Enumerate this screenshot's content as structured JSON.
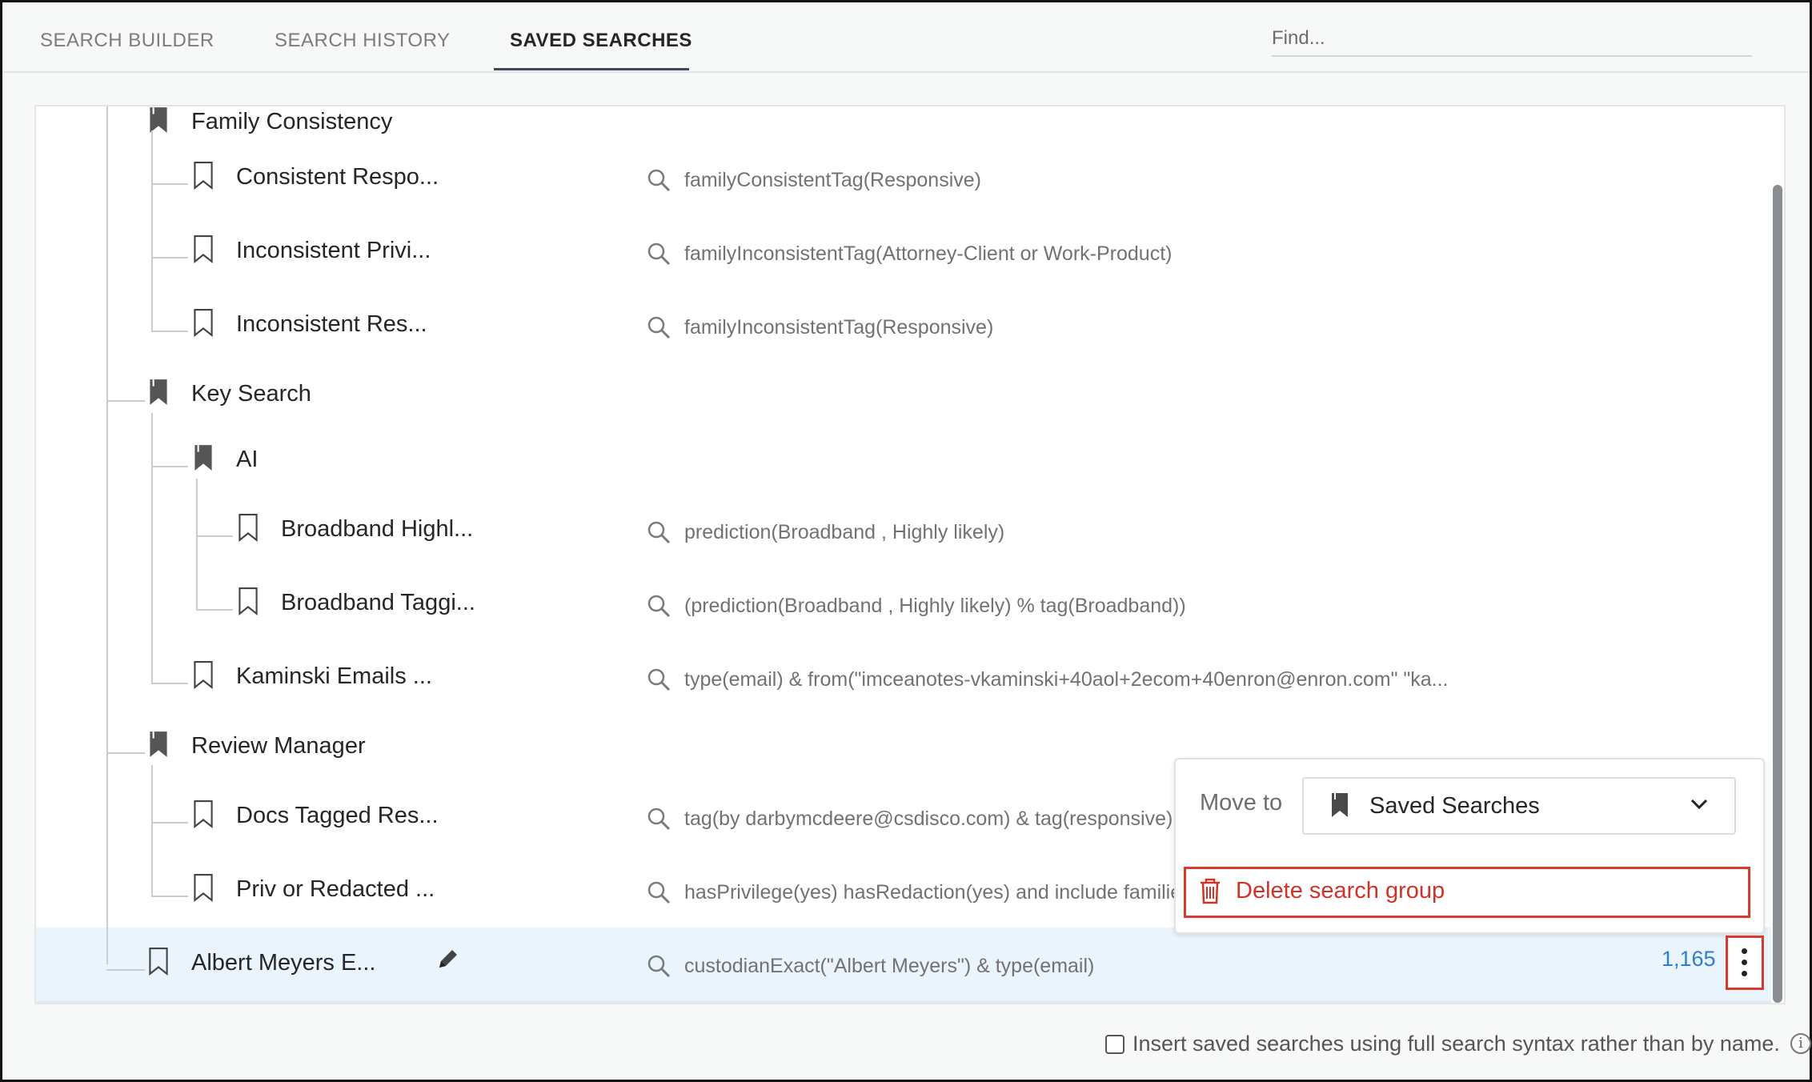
{
  "tabs": [
    {
      "label": "SEARCH BUILDER",
      "active": false
    },
    {
      "label": "SEARCH HISTORY",
      "active": false
    },
    {
      "label": "SAVED SEARCHES",
      "active": true
    }
  ],
  "find": {
    "placeholder": "Find..."
  },
  "rows": [
    {
      "type": "group",
      "name": "Family Consistency",
      "query": ""
    },
    {
      "type": "search",
      "name": "Consistent Respo...",
      "query": "familyConsistentTag(Responsive)"
    },
    {
      "type": "search",
      "name": "Inconsistent Privi...",
      "query": "familyInconsistentTag(Attorney-Client or Work-Product)"
    },
    {
      "type": "search",
      "name": "Inconsistent Res...",
      "query": "familyInconsistentTag(Responsive)"
    },
    {
      "type": "group",
      "name": "Key Search",
      "query": ""
    },
    {
      "type": "group",
      "name": "AI",
      "query": ""
    },
    {
      "type": "search",
      "name": "Broadband Highl...",
      "query": "prediction(Broadband , Highly likely)"
    },
    {
      "type": "search",
      "name": "Broadband Taggi...",
      "query": "(prediction(Broadband , Highly likely) % tag(Broadband))"
    },
    {
      "type": "search",
      "name": "Kaminski Emails ...",
      "query": "type(email) & from(\"imceanotes-vkaminski+40aol+2ecom+40enron@enron.com\" \"ka..."
    },
    {
      "type": "group",
      "name": "Review Manager",
      "query": ""
    },
    {
      "type": "search",
      "name": "Docs Tagged Res...",
      "query": "tag(by darbymcdeere@csdisco.com) & tag(responsive)"
    },
    {
      "type": "search",
      "name": "Priv or Redacted ...",
      "query": "hasPrivilege(yes) hasRedaction(yes) and include familie"
    },
    {
      "type": "search",
      "name": "Albert Meyers E...",
      "query": "custodianExact(\"Albert Meyers\") & type(email)",
      "count": "1,165",
      "selected": true
    }
  ],
  "popup": {
    "move_to_label": "Move to",
    "move_to_value": "Saved Searches",
    "delete_label": "Delete search group"
  },
  "footer": {
    "checkbox_label": "Insert saved searches using full search syntax rather than by name.",
    "checked": false
  },
  "colors": {
    "accent": "#2c7fd1",
    "danger": "#d23228",
    "selected_row": "#eaf4fc"
  },
  "icons": {
    "group": "bookmark-filled-icon",
    "search": "bookmark-outline-icon",
    "query": "search-icon",
    "edit": "pencil-icon",
    "more": "kebab-icon",
    "delete": "trash-icon",
    "dropdown": "chevron-down-icon"
  }
}
